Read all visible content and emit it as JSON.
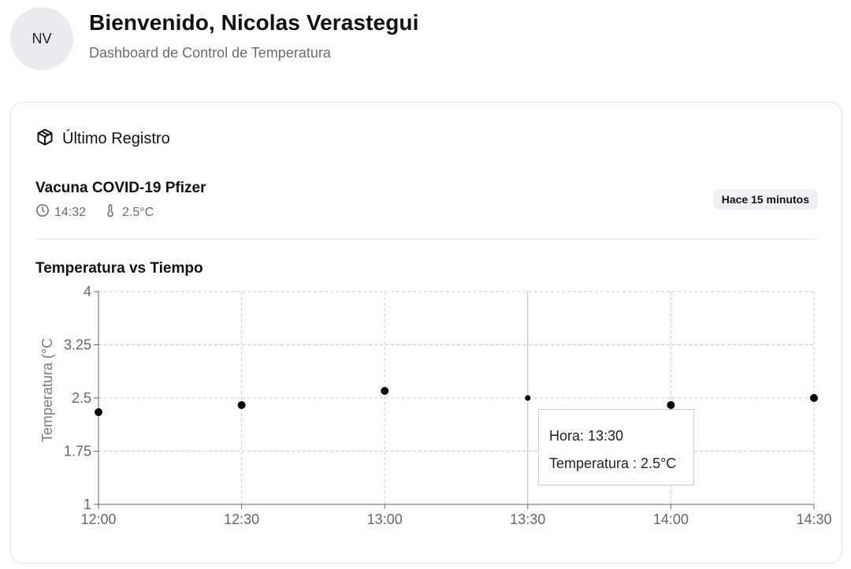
{
  "header": {
    "avatar_initials": "NV",
    "title": "Bienvenido, Nicolas Verastegui",
    "subtitle": "Dashboard de Control de Temperatura"
  },
  "card": {
    "icon": "package-icon",
    "heading": "Último Registro",
    "record": {
      "name": "Vacuna COVID-19 Pfizer",
      "time": "14:32",
      "time_icon": "clock-icon",
      "temperature": "2.5°C",
      "temperature_icon": "thermometer-icon",
      "badge": "Hace 15 minutos"
    }
  },
  "chart_title": "Temperatura vs Tiempo",
  "tooltip": {
    "hora": "Hora: 13:30",
    "temperatura": "Temperatura : 2.5°C"
  },
  "chart_data": {
    "type": "scatter",
    "x": [
      "12:00",
      "12:30",
      "13:00",
      "13:30",
      "14:00",
      "14:30"
    ],
    "y": [
      2.3,
      2.4,
      2.6,
      2.5,
      2.4,
      2.5
    ],
    "ylabel": "Temperatura (°C",
    "xlabel": "",
    "ylim": [
      1,
      4
    ],
    "yticks": [
      "1",
      "1.75",
      "2.5",
      "3.25",
      "4"
    ],
    "grid": true,
    "highlighted_index": 3,
    "colors": {
      "point": "#000000",
      "grid": "#cccccc",
      "axis": "#666666",
      "tick_text": "#666666"
    }
  }
}
